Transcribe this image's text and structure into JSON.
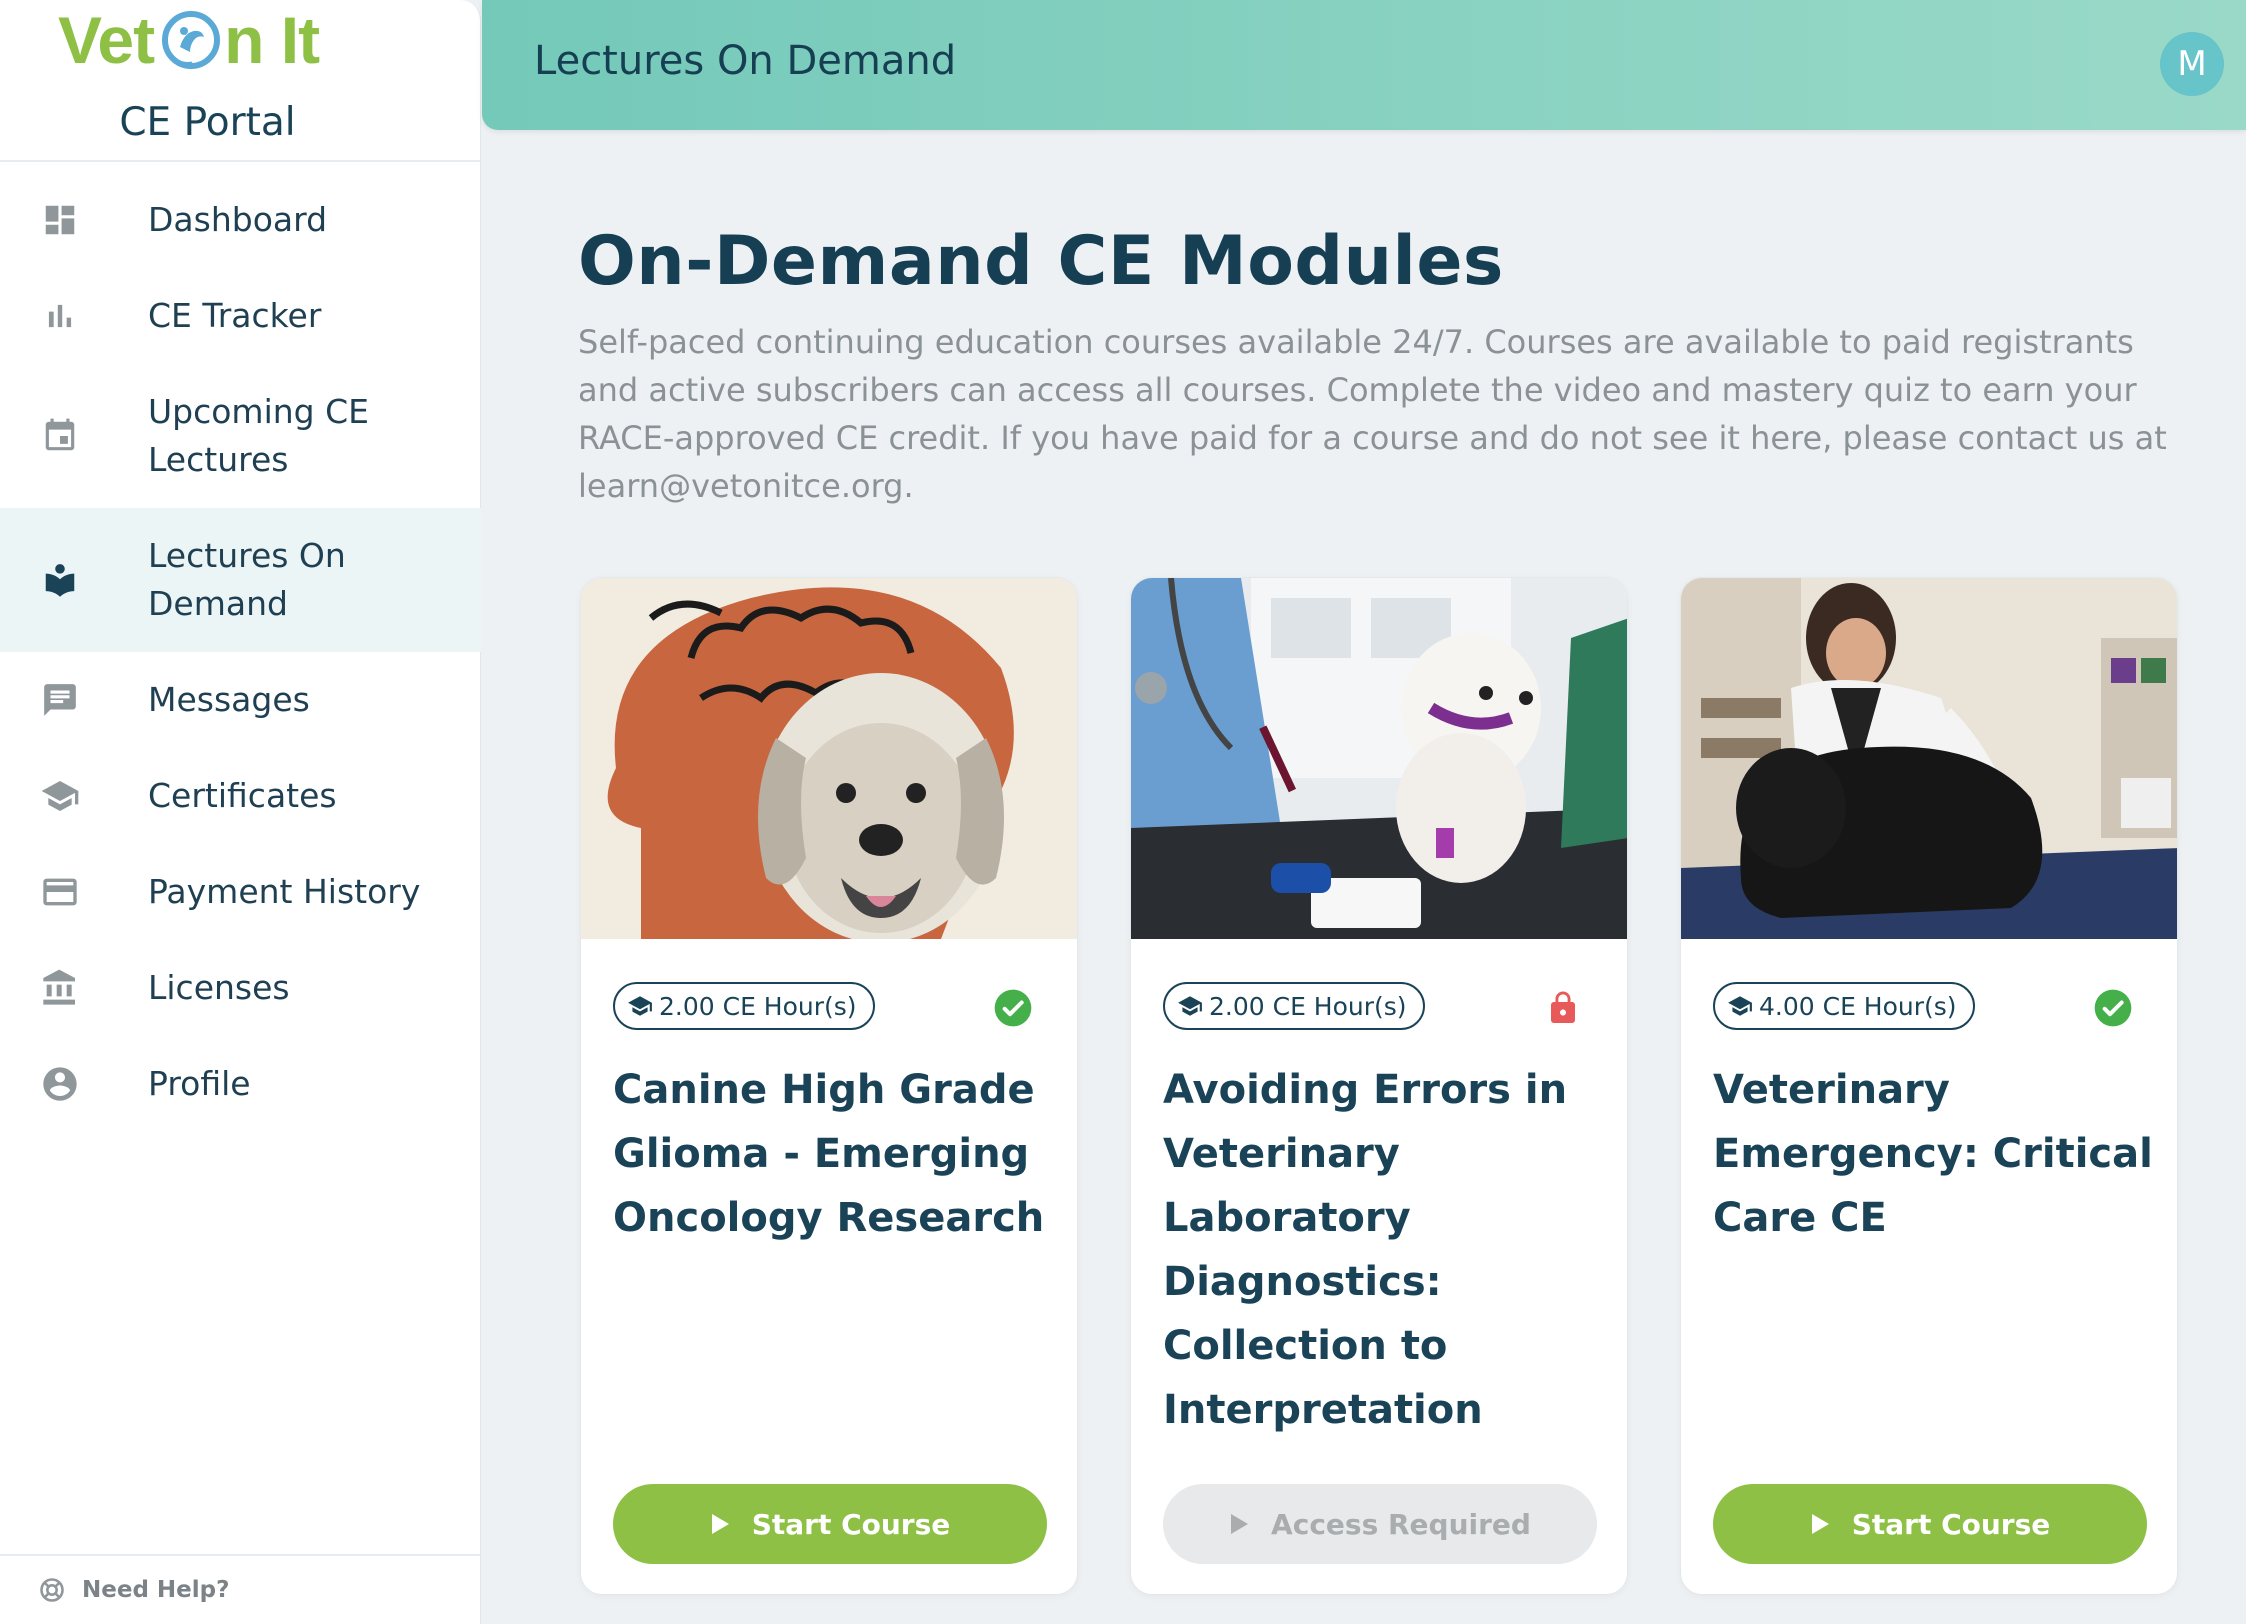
{
  "brand": {
    "logo_left": "Vet",
    "logo_right": "n It",
    "portal_title": "CE Portal"
  },
  "sidebar": {
    "items": [
      {
        "label": "Dashboard",
        "icon": "dashboard-icon"
      },
      {
        "label": "CE Tracker",
        "icon": "bar-chart-icon"
      },
      {
        "label": "Upcoming CE Lectures",
        "icon": "calendar-icon"
      },
      {
        "label": "Lectures On Demand",
        "icon": "reader-icon",
        "active": true
      },
      {
        "label": "Messages",
        "icon": "message-icon"
      },
      {
        "label": "Certificates",
        "icon": "graduation-cap-icon"
      },
      {
        "label": "Payment History",
        "icon": "credit-card-icon"
      },
      {
        "label": "Licenses",
        "icon": "institution-icon"
      },
      {
        "label": "Profile",
        "icon": "account-circle-icon"
      }
    ],
    "help_label": "Need Help?"
  },
  "header": {
    "title": "Lectures On Demand",
    "avatar_initial": "M"
  },
  "main": {
    "heading": "On-Demand CE Modules",
    "description": "Self-paced continuing education courses available 24/7. Courses are available to paid registrants and active subscribers can access all courses. Complete the video and mastery quiz to earn your RACE-approved CE credit. If you have paid for a course and do not see it here, please contact us at learn@vetonitce.org."
  },
  "courses": [
    {
      "ce_hours": "2.00 CE Hour(s)",
      "status": "completed",
      "title": "Canine High Grade Glioma - Emerging Oncology Research",
      "cta": "Start Course",
      "cta_enabled": true
    },
    {
      "ce_hours": "2.00 CE Hour(s)",
      "status": "locked",
      "title": "Avoiding Errors in Veterinary Laboratory Diagnostics: Collection to Interpretation",
      "cta": "Access Required",
      "cta_enabled": false
    },
    {
      "ce_hours": "4.00 CE Hour(s)",
      "status": "completed",
      "title": "Veterinary Emergency: Critical Care CE",
      "cta": "Start Course",
      "cta_enabled": true
    }
  ],
  "colors": {
    "brand_green": "#8dc044",
    "navy": "#1a4358",
    "header_teal": "#74c9b9",
    "lock_red": "#e85a5a"
  }
}
